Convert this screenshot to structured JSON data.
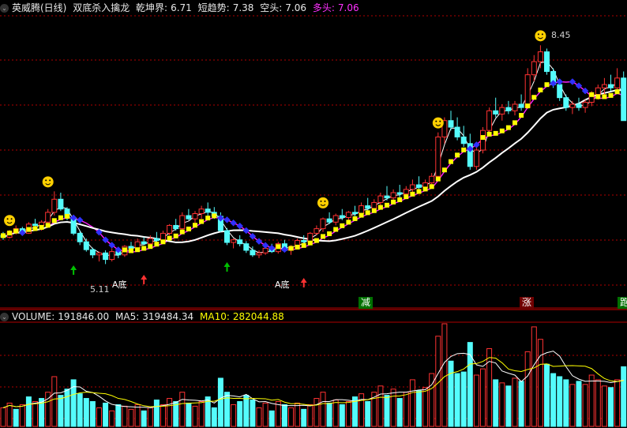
{
  "header": {
    "stock_name": "英威腾(日线)",
    "indicator_name": "双底杀入擒龙",
    "qiankun_label": "乾坤界:",
    "qiankun_value": "6.71",
    "short_label": "短趋势:",
    "short_value": "7.38",
    "kong_label": "空头:",
    "kong_value": "7.06",
    "duo_label": "多头:",
    "duo_value": "7.06"
  },
  "volume_header": {
    "label": "VOLUME:",
    "value": "191846.00",
    "ma5_label": "MA5:",
    "ma5_value": "319484.34",
    "ma10_label": "MA10:",
    "ma10_value": "282044.88"
  },
  "annotations": {
    "high_label": "8.45",
    "low_label": "5.11",
    "double_bottom_1": "A底",
    "double_bottom_2": "A底",
    "tag_jian": "减",
    "tag_zhang": "涨",
    "tag_pao": "跑"
  },
  "colors": {
    "up": "#ff3232",
    "down": "#54fcfc",
    "yellow": "#ffff00",
    "white": "#ffffff",
    "magenta": "#ff20ff",
    "blue": "#3030ff",
    "grid": "#b00000",
    "green": "#00c000"
  },
  "chart_data": {
    "type": "candlestick",
    "price_range": [
      4.5,
      8.9
    ],
    "candles": [
      [
        5.55,
        5.6,
        5.48,
        5.52
      ],
      [
        5.52,
        5.63,
        5.5,
        5.6
      ],
      [
        5.6,
        5.7,
        5.56,
        5.65
      ],
      [
        5.65,
        5.68,
        5.55,
        5.58
      ],
      [
        5.58,
        5.75,
        5.57,
        5.72
      ],
      [
        5.72,
        5.8,
        5.66,
        5.7
      ],
      [
        5.7,
        5.78,
        5.62,
        5.75
      ],
      [
        5.75,
        5.95,
        5.72,
        5.9
      ],
      [
        5.9,
        6.22,
        5.85,
        6.1
      ],
      [
        6.1,
        6.2,
        5.92,
        5.95
      ],
      [
        5.95,
        5.98,
        5.78,
        5.82
      ],
      [
        5.82,
        5.84,
        5.55,
        5.58
      ],
      [
        5.58,
        5.62,
        5.4,
        5.45
      ],
      [
        5.45,
        5.5,
        5.3,
        5.33
      ],
      [
        5.33,
        5.36,
        5.2,
        5.25
      ],
      [
        5.25,
        5.3,
        5.15,
        5.28
      ],
      [
        5.28,
        5.32,
        5.11,
        5.18
      ],
      [
        5.18,
        5.35,
        5.15,
        5.3
      ],
      [
        5.3,
        5.33,
        5.2,
        5.25
      ],
      [
        5.25,
        5.4,
        5.22,
        5.38
      ],
      [
        5.38,
        5.45,
        5.3,
        5.35
      ],
      [
        5.35,
        5.5,
        5.32,
        5.45
      ],
      [
        5.45,
        5.52,
        5.4,
        5.42
      ],
      [
        5.42,
        5.55,
        5.38,
        5.5
      ],
      [
        5.5,
        5.6,
        5.44,
        5.47
      ],
      [
        5.47,
        5.62,
        5.45,
        5.58
      ],
      [
        5.58,
        5.72,
        5.55,
        5.7
      ],
      [
        5.7,
        5.8,
        5.62,
        5.65
      ],
      [
        5.65,
        5.9,
        5.6,
        5.85
      ],
      [
        5.85,
        5.95,
        5.78,
        5.8
      ],
      [
        5.8,
        5.92,
        5.72,
        5.88
      ],
      [
        5.88,
        6.0,
        5.8,
        5.95
      ],
      [
        5.95,
        6.05,
        5.85,
        5.9
      ],
      [
        5.9,
        5.98,
        5.8,
        5.84
      ],
      [
        5.84,
        5.9,
        5.6,
        5.62
      ],
      [
        5.62,
        5.66,
        5.4,
        5.44
      ],
      [
        5.44,
        5.5,
        5.35,
        5.48
      ],
      [
        5.48,
        5.55,
        5.38,
        5.42
      ],
      [
        5.42,
        5.46,
        5.28,
        5.32
      ],
      [
        5.32,
        5.38,
        5.22,
        5.25
      ],
      [
        5.25,
        5.32,
        5.2,
        5.28
      ],
      [
        5.28,
        5.4,
        5.25,
        5.35
      ],
      [
        5.35,
        5.42,
        5.28,
        5.3
      ],
      [
        5.3,
        5.45,
        5.27,
        5.42
      ],
      [
        5.42,
        5.48,
        5.3,
        5.32
      ],
      [
        5.32,
        5.4,
        5.25,
        5.37
      ],
      [
        5.37,
        5.5,
        5.34,
        5.47
      ],
      [
        5.47,
        5.55,
        5.4,
        5.45
      ],
      [
        5.45,
        5.6,
        5.42,
        5.58
      ],
      [
        5.58,
        5.7,
        5.55,
        5.65
      ],
      [
        5.65,
        5.82,
        5.6,
        5.8
      ],
      [
        5.8,
        5.9,
        5.72,
        5.75
      ],
      [
        5.75,
        5.88,
        5.7,
        5.85
      ],
      [
        5.85,
        5.95,
        5.78,
        5.82
      ],
      [
        5.82,
        5.92,
        5.76,
        5.9
      ],
      [
        5.9,
        6.0,
        5.84,
        5.88
      ],
      [
        5.88,
        6.05,
        5.85,
        6.0
      ],
      [
        6.0,
        6.12,
        5.92,
        5.96
      ],
      [
        5.96,
        6.1,
        5.9,
        6.05
      ],
      [
        6.05,
        6.2,
        6.0,
        6.15
      ],
      [
        6.15,
        6.3,
        6.08,
        6.12
      ],
      [
        6.12,
        6.25,
        6.05,
        6.2
      ],
      [
        6.2,
        6.32,
        6.12,
        6.18
      ],
      [
        6.18,
        6.3,
        6.1,
        6.25
      ],
      [
        6.25,
        6.4,
        6.2,
        6.32
      ],
      [
        6.32,
        6.45,
        6.25,
        6.28
      ],
      [
        6.28,
        6.4,
        6.22,
        6.35
      ],
      [
        6.35,
        6.5,
        6.3,
        6.45
      ],
      [
        6.45,
        7.12,
        6.4,
        7.05
      ],
      [
        7.05,
        7.35,
        6.95,
        7.3
      ],
      [
        7.3,
        7.45,
        7.15,
        7.2
      ],
      [
        7.2,
        7.35,
        7.0,
        7.05
      ],
      [
        7.05,
        7.22,
        6.9,
        6.95
      ],
      [
        6.95,
        7.1,
        6.55,
        6.6
      ],
      [
        6.6,
        6.9,
        6.55,
        6.85
      ],
      [
        6.85,
        7.2,
        6.8,
        7.15
      ],
      [
        7.15,
        7.5,
        7.1,
        7.45
      ],
      [
        7.45,
        7.65,
        7.35,
        7.4
      ],
      [
        7.4,
        7.55,
        7.3,
        7.5
      ],
      [
        7.5,
        7.6,
        7.4,
        7.45
      ],
      [
        7.45,
        7.6,
        7.38,
        7.55
      ],
      [
        7.55,
        7.7,
        7.45,
        7.5
      ],
      [
        7.5,
        8.1,
        7.48,
        8.0
      ],
      [
        8.0,
        8.3,
        7.9,
        8.2
      ],
      [
        8.2,
        8.45,
        8.1,
        8.35
      ],
      [
        8.35,
        8.4,
        8.0,
        8.05
      ],
      [
        8.05,
        8.1,
        7.8,
        7.85
      ],
      [
        7.85,
        7.9,
        7.6,
        7.65
      ],
      [
        7.65,
        7.7,
        7.45,
        7.5
      ],
      [
        7.5,
        7.6,
        7.4,
        7.55
      ],
      [
        7.55,
        7.65,
        7.45,
        7.5
      ],
      [
        7.5,
        7.62,
        7.42,
        7.58
      ],
      [
        7.58,
        7.75,
        7.52,
        7.7
      ],
      [
        7.7,
        7.85,
        7.62,
        7.8
      ],
      [
        7.8,
        7.95,
        7.7,
        7.85
      ],
      [
        7.85,
        8.0,
        7.75,
        7.8
      ],
      [
        7.8,
        8.1,
        7.75,
        7.95
      ],
      [
        7.95,
        8.05,
        7.6,
        7.3
      ]
    ],
    "volume_range": [
      0,
      330000
    ],
    "volumes": [
      [
        60000,
        1
      ],
      [
        75000,
        1
      ],
      [
        55000,
        0
      ],
      [
        70000,
        1
      ],
      [
        95000,
        0
      ],
      [
        80000,
        1
      ],
      [
        90000,
        0
      ],
      [
        110000,
        1
      ],
      [
        160000,
        1
      ],
      [
        100000,
        0
      ],
      [
        120000,
        0
      ],
      [
        150000,
        0
      ],
      [
        105000,
        0
      ],
      [
        90000,
        0
      ],
      [
        80000,
        0
      ],
      [
        60000,
        1
      ],
      [
        75000,
        0
      ],
      [
        50000,
        1
      ],
      [
        70000,
        0
      ],
      [
        65000,
        1
      ],
      [
        55000,
        1
      ],
      [
        70000,
        1
      ],
      [
        50000,
        0
      ],
      [
        60000,
        1
      ],
      [
        85000,
        0
      ],
      [
        70000,
        1
      ],
      [
        90000,
        1
      ],
      [
        80000,
        0
      ],
      [
        110000,
        1
      ],
      [
        75000,
        0
      ],
      [
        65000,
        1
      ],
      [
        80000,
        1
      ],
      [
        95000,
        0
      ],
      [
        60000,
        0
      ],
      [
        155000,
        0
      ],
      [
        110000,
        0
      ],
      [
        70000,
        1
      ],
      [
        80000,
        0
      ],
      [
        100000,
        0
      ],
      [
        85000,
        0
      ],
      [
        60000,
        1
      ],
      [
        75000,
        1
      ],
      [
        50000,
        0
      ],
      [
        80000,
        1
      ],
      [
        70000,
        0
      ],
      [
        60000,
        1
      ],
      [
        75000,
        1
      ],
      [
        55000,
        0
      ],
      [
        70000,
        1
      ],
      [
        90000,
        1
      ],
      [
        110000,
        1
      ],
      [
        75000,
        0
      ],
      [
        85000,
        1
      ],
      [
        70000,
        0
      ],
      [
        80000,
        1
      ],
      [
        95000,
        0
      ],
      [
        105000,
        1
      ],
      [
        80000,
        0
      ],
      [
        110000,
        1
      ],
      [
        130000,
        1
      ],
      [
        100000,
        0
      ],
      [
        120000,
        1
      ],
      [
        90000,
        0
      ],
      [
        110000,
        1
      ],
      [
        150000,
        1
      ],
      [
        115000,
        0
      ],
      [
        125000,
        1
      ],
      [
        170000,
        1
      ],
      [
        290000,
        1
      ],
      [
        330000,
        1
      ],
      [
        210000,
        0
      ],
      [
        170000,
        0
      ],
      [
        175000,
        0
      ],
      [
        270000,
        0
      ],
      [
        165000,
        1
      ],
      [
        185000,
        1
      ],
      [
        250000,
        1
      ],
      [
        150000,
        0
      ],
      [
        140000,
        1
      ],
      [
        130000,
        0
      ],
      [
        155000,
        1
      ],
      [
        145000,
        0
      ],
      [
        240000,
        1
      ],
      [
        320000,
        1
      ],
      [
        280000,
        1
      ],
      [
        200000,
        0
      ],
      [
        170000,
        0
      ],
      [
        160000,
        0
      ],
      [
        150000,
        0
      ],
      [
        135000,
        1
      ],
      [
        145000,
        0
      ],
      [
        135000,
        1
      ],
      [
        165000,
        1
      ],
      [
        150000,
        1
      ],
      [
        130000,
        1
      ],
      [
        125000,
        0
      ],
      [
        150000,
        1
      ],
      [
        191846,
        0
      ]
    ]
  }
}
